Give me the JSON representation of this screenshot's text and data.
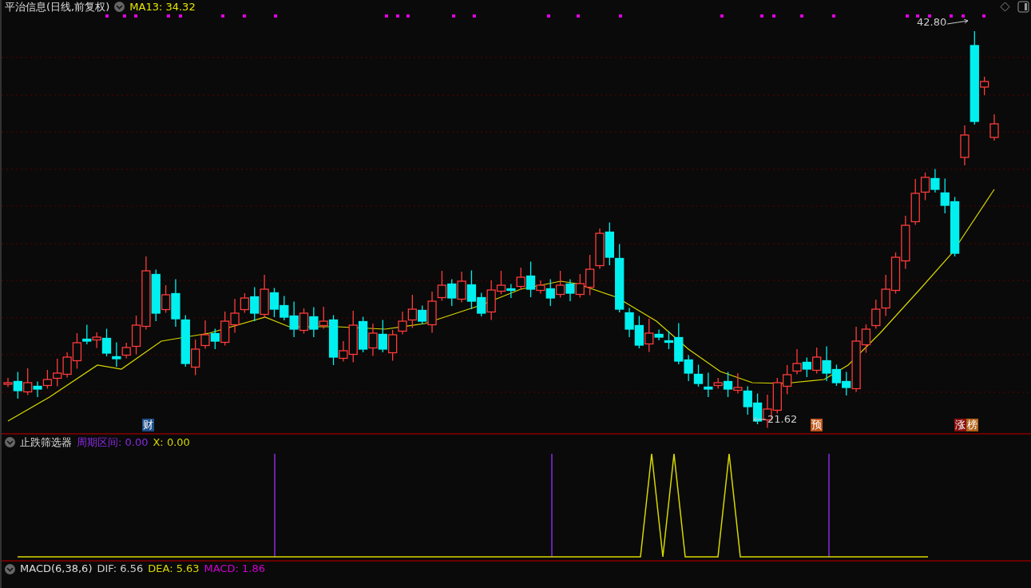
{
  "header": {
    "title": "平治信息(日线,前复权)",
    "indicator": "MA13: 34.32"
  },
  "price_labels": [
    {
      "kind": "high",
      "text": "42.80"
    },
    {
      "kind": "low",
      "text": "21.62"
    }
  ],
  "event_badges": [
    {
      "text": "财",
      "color": "#1e4f8a"
    },
    {
      "text": "预",
      "color": "#c0561a"
    },
    {
      "text": "涨",
      "color": "#8a0f0f"
    },
    {
      "text": "榜",
      "color": "#b0641a"
    }
  ],
  "indicator_panel": {
    "title": "止跌筛选器",
    "readings": [
      {
        "text": "周期区间: 0.00",
        "color": "#8a2be2"
      },
      {
        "text": "X: 0.00",
        "color": "#d8d800"
      }
    ]
  },
  "macd_panel": {
    "title": "MACD(6,38,6)",
    "readings": [
      {
        "text": "DIF: 6.56",
        "color": "#cccccc"
      },
      {
        "text": "DEA: 5.63",
        "color": "#d8d800"
      },
      {
        "text": "MACD: 1.86",
        "color": "#d000d0"
      }
    ]
  }
}
